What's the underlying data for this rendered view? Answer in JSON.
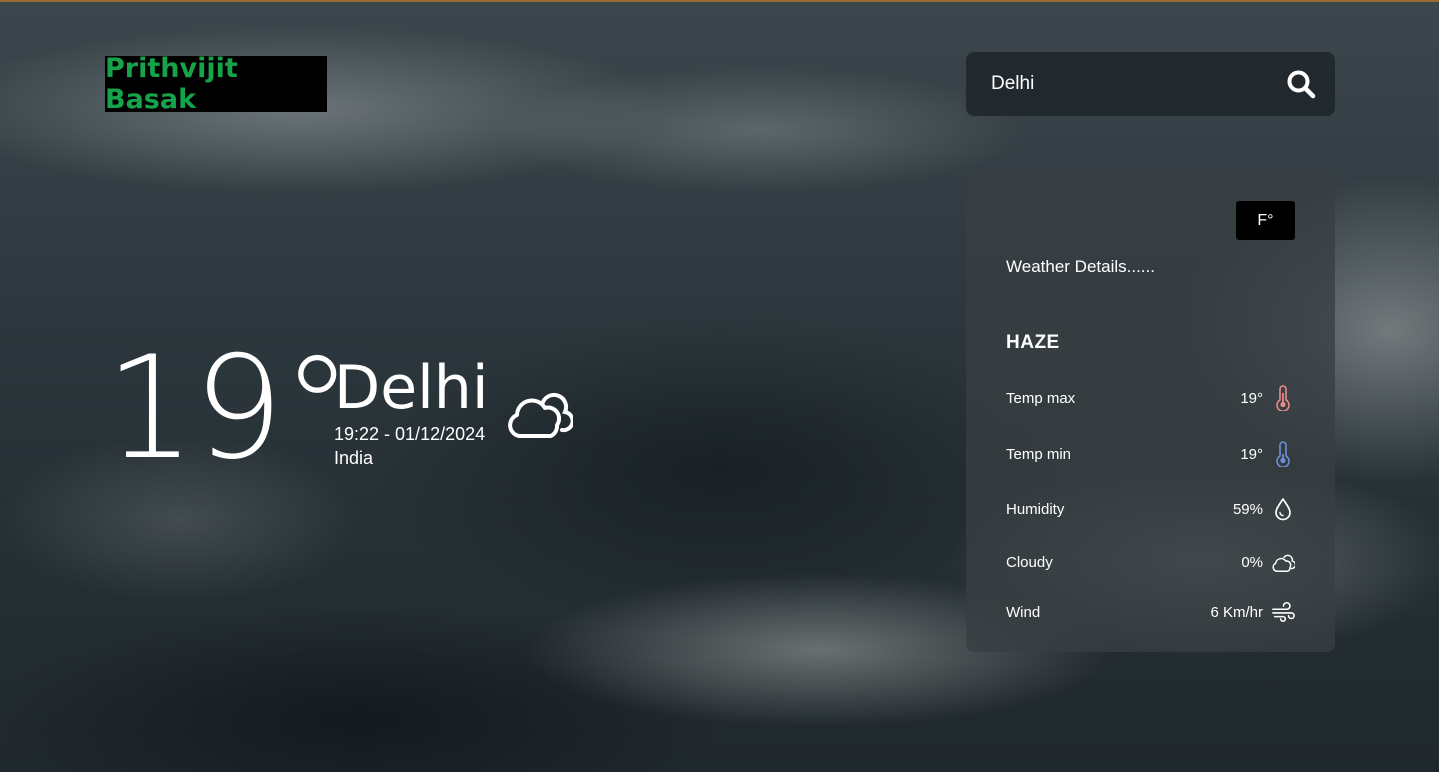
{
  "brand": {
    "name": "Prithvijit Basak",
    "color": "#16a34a"
  },
  "search": {
    "value": "Delhi",
    "icon": "search-icon"
  },
  "current": {
    "temperature": "19°",
    "city": "Delhi",
    "datetime": "19:22 - 01/12/2024",
    "country": "India",
    "icon": "cloudy-icon"
  },
  "details": {
    "unit_toggle": "F°",
    "title": "Weather Details......",
    "condition": "HAZE",
    "rows": [
      {
        "label": "Temp max",
        "value": "19°",
        "icon": "thermometer-hot-icon",
        "icon_color": "#e88a8a"
      },
      {
        "label": "Temp min",
        "value": "19°",
        "icon": "thermometer-cold-icon",
        "icon_color": "#6d8fd6"
      },
      {
        "label": "Humidity",
        "value": "59%",
        "icon": "droplet-icon",
        "icon_color": "#ffffff"
      },
      {
        "label": "Cloudy",
        "value": "0%",
        "icon": "cloud-icon",
        "icon_color": "#ffffff"
      },
      {
        "label": "Wind",
        "value": "6 Km/hr",
        "icon": "wind-icon",
        "icon_color": "#ffffff"
      }
    ]
  }
}
